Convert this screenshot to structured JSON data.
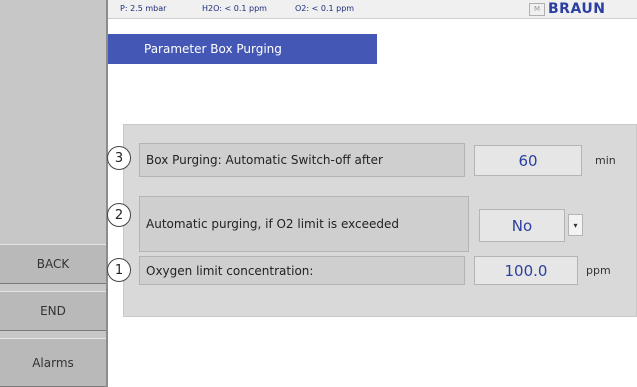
{
  "status": {
    "pressure": "P:  2.5 mbar",
    "h2o": "H2O:  < 0.1 ppm",
    "o2": "O2:  < 0.1 ppm"
  },
  "brand": {
    "logo_text": "BRAUN",
    "logo_prefix": "M"
  },
  "title": "Parameter Box Purging",
  "sidebar": {
    "back": "BACK",
    "end": "END",
    "alarms": "Alarms"
  },
  "rows": [
    {
      "number": "3",
      "label": "Box Purging: Automatic Switch-off after",
      "value": "60",
      "unit": "min"
    },
    {
      "number": "2",
      "label": "Automatic purging, if O2 limit is exceeded",
      "value": "No",
      "dropdown_icon": "chevron-down-icon"
    },
    {
      "number": "1",
      "label": "Oxygen limit concentration:",
      "value": "100.0",
      "unit": "ppm"
    }
  ],
  "colors": {
    "accent": "#4457b4",
    "value_text": "#2c3f9e",
    "sidebar": "#c7c7c7"
  }
}
